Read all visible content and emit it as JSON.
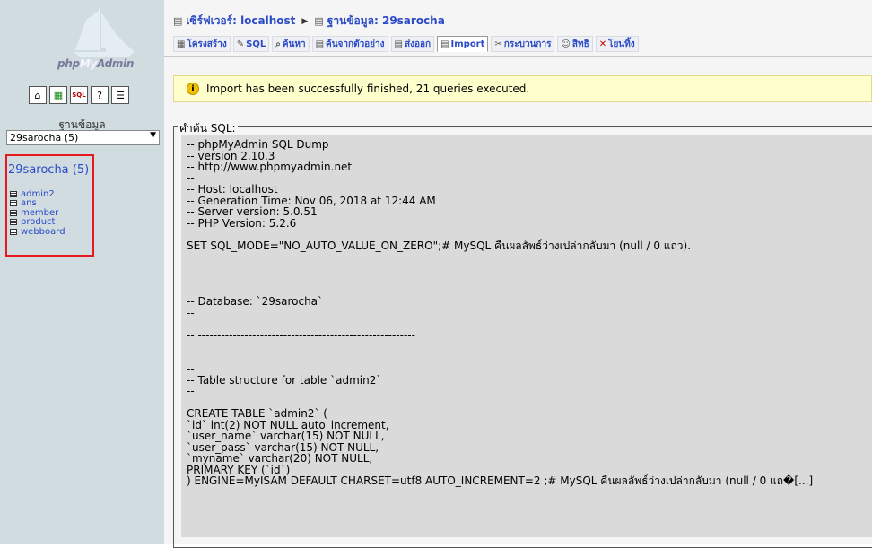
{
  "sidebar": {
    "logo_pre": "php",
    "logo_mid": "My",
    "logo_post": "Admin",
    "nav_icons": [
      "home-icon",
      "query-window-icon",
      "sql-icon",
      "docs-icon",
      "info-icon"
    ],
    "db_label": "ฐานข้อมูล",
    "db_select_value": "29sarocha (5)",
    "db_title": "29sarocha (5)",
    "tables": [
      "admin2",
      "ans",
      "member",
      "product",
      "webboard"
    ]
  },
  "breadcrumb": {
    "server": "เซิร์ฟเวอร์: localhost",
    "database": "ฐานข้อมูล: 29sarocha"
  },
  "tabs": [
    {
      "label": "โครงสร้าง",
      "icon": "structure-icon"
    },
    {
      "label": "SQL",
      "icon": "sql-icon"
    },
    {
      "label": "ค้นหา",
      "icon": "search-icon"
    },
    {
      "label": "ค้นจากตัวอย่าง",
      "icon": "query-icon"
    },
    {
      "label": "ส่งออก",
      "icon": "export-icon"
    },
    {
      "label": "Import",
      "icon": "import-icon",
      "active": true
    },
    {
      "label": "กระบวนการ",
      "icon": "operations-icon"
    },
    {
      "label": "สิทธิ",
      "icon": "privileges-icon"
    },
    {
      "label": "โยนทิ้ง",
      "icon": "drop-icon"
    }
  ],
  "notice": "Import has been successfully finished, 21 queries executed.",
  "sql": {
    "legend": "คำค้น SQL:",
    "lines": [
      "-- phpMyAdmin SQL Dump",
      "-- version 2.10.3",
      "-- http://www.phpmyadmin.net",
      "--",
      "-- Host: localhost",
      "-- Generation Time: Nov 06, 2018 at 12:44 AM",
      "-- Server version: 5.0.51",
      "-- PHP Version: 5.2.6",
      "",
      "SET SQL_MODE=\"NO_AUTO_VALUE_ON_ZERO\";# MySQL คืนผลลัพธ์ว่างเปล่ากลับมา (null / 0 แถว).",
      "",
      "",
      "",
      "--",
      "-- Database: `29sarocha`",
      "--",
      "",
      "-- --------------------------------------------------------",
      "",
      "",
      "--",
      "-- Table structure for table `admin2`",
      "--",
      "",
      "CREATE TABLE `admin2` (",
      "`id` int(2) NOT NULL auto_increment,",
      "`user_name` varchar(15) NOT NULL,",
      "`user_pass` varchar(15) NOT NULL,",
      "`myname` varchar(20) NOT NULL,",
      "PRIMARY KEY (`id`)",
      ") ENGINE=MyISAM DEFAULT CHARSET=utf8 AUTO_INCREMENT=2 ;# MySQL คืนผลลัพธ์ว่างเปล่ากลับมา (null / 0 แถ�[...]"
    ]
  }
}
